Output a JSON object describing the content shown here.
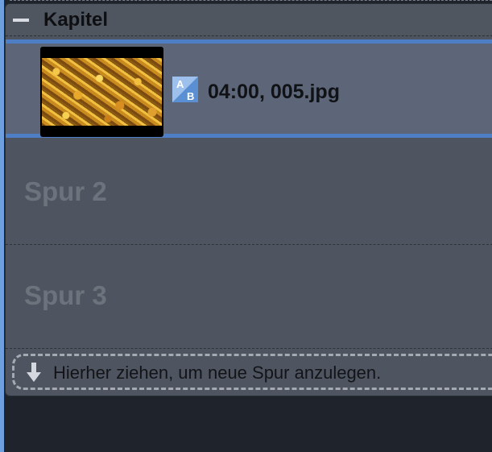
{
  "chapter": {
    "title": "Kapitel",
    "collapse_icon": "minus-icon"
  },
  "tracks": [
    {
      "clip": {
        "duration": "04:00",
        "filename": "005.jpg",
        "label": "04:00, 005.jpg",
        "thumbnail_icon": "autumn-leaves-thumbnail",
        "transition_icon": "ab-transition-icon"
      },
      "indicator_icon": "track-active-indicator-icon",
      "selected": true
    },
    {
      "label": "Spur 2"
    },
    {
      "label": "Spur 3"
    }
  ],
  "drop_zone": {
    "icon": "arrow-down-icon",
    "text": "Hierher ziehen, um neue Spur anzulegen."
  },
  "colors": {
    "background": "#1f232b",
    "panel": "#4f5560",
    "selected_track": "#5c6678",
    "selection_border": "#4e7ec6",
    "accent_strip": "#6ea0e0"
  }
}
